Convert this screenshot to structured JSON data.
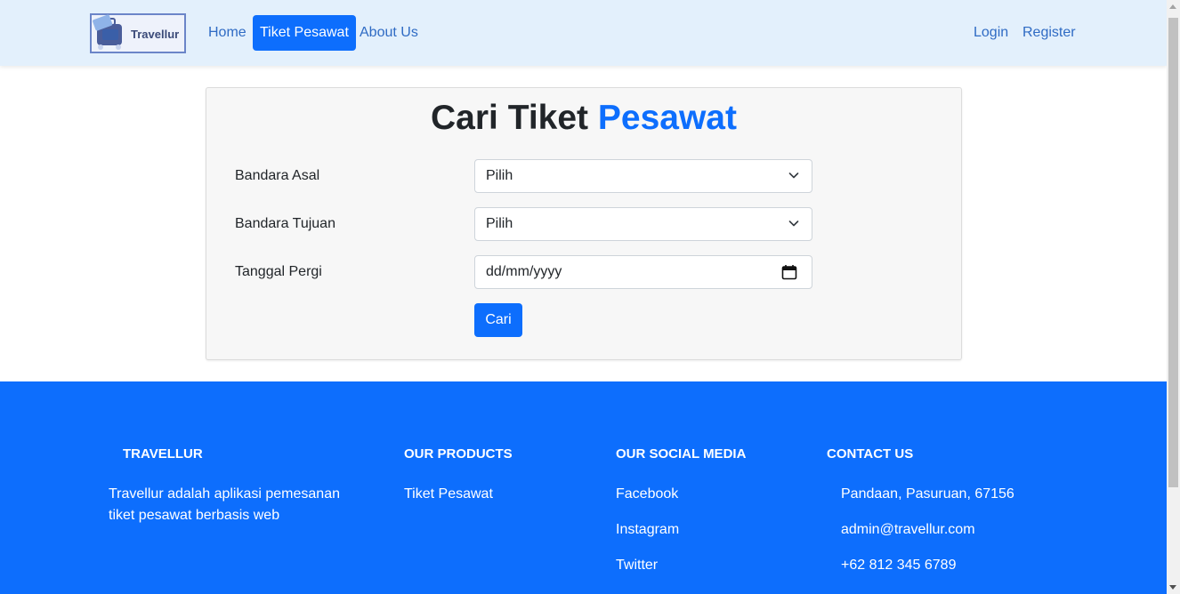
{
  "navbar": {
    "logo_text": "Travellur",
    "links": [
      {
        "label": "Home"
      },
      {
        "label": "Tiket Pesawat",
        "active": true
      },
      {
        "label": "About Us"
      }
    ],
    "auth": {
      "login": "Login",
      "register": "Register"
    }
  },
  "search": {
    "title_main": "Cari Tiket",
    "title_accent": "Pesawat",
    "fields": {
      "origin": {
        "label": "Bandara Asal",
        "value": "Pilih"
      },
      "destination": {
        "label": "Bandara Tujuan",
        "value": "Pilih"
      },
      "date": {
        "label": "Tanggal Pergi",
        "placeholder": "dd/mm/yyyy"
      }
    },
    "submit_label": "Cari"
  },
  "footer": {
    "brand": {
      "heading": "TRAVELLUR",
      "line1": "Travellur adalah aplikasi pemesanan",
      "line2": "tiket pesawat berbasis web"
    },
    "products": {
      "heading": "OUR PRODUCTS",
      "items": [
        "Tiket Pesawat"
      ]
    },
    "social": {
      "heading": "OUR SOCIAL MEDIA",
      "items": [
        "Facebook",
        "Instagram",
        "Twitter"
      ]
    },
    "contact": {
      "heading": "CONTACT US",
      "items": [
        "Pandaan, Pasuruan, 67156",
        "admin@travellur.com",
        "+62 812 345 6789"
      ]
    }
  },
  "colors": {
    "primary": "#0d6efd",
    "navbar_bg": "#e3f0fc",
    "card_bg": "#f7f7f7"
  }
}
